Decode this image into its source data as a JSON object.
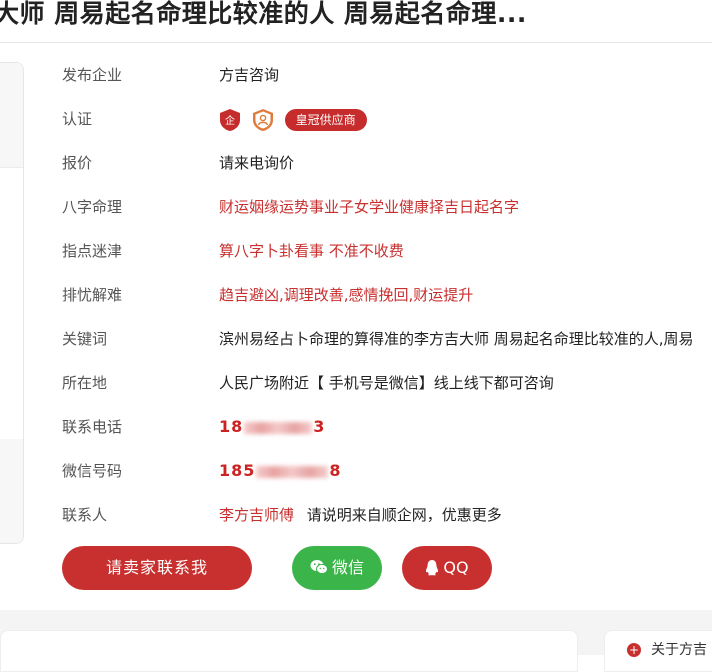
{
  "title": "大师 周易起名命理比较准的人 周易起名命理...",
  "details": {
    "publisher": {
      "label": "发布企业",
      "value": "方吉咨询"
    },
    "certification": {
      "label": "认证",
      "badge": "皇冠供应商",
      "icons": [
        "enterprise-cert-icon",
        "personal-cert-icon"
      ]
    },
    "price": {
      "label": "报价",
      "value": "请来电询价"
    },
    "bazi": {
      "label": "八字命理",
      "value": "财运姻缘运势事业子女学业健康择吉日起名字"
    },
    "guidance": {
      "label": "指点迷津",
      "value": "算八字卜卦看事 不准不收费"
    },
    "relief": {
      "label": "排忧解难",
      "value": "趋吉避凶,调理改善,感情挽回,财运提升"
    },
    "keywords": {
      "label": "关键词",
      "value": "滨州易经占卜命理的算得准的李方吉大师 周易起名命理比较准的人,周易"
    },
    "location": {
      "label": "所在地",
      "value": "人民广场附近【 手机号是微信】线上线下都可咨询"
    },
    "phone": {
      "label": "联系电话",
      "prefix": "18",
      "suffix": "3"
    },
    "wechat": {
      "label": "微信号码",
      "prefix": "185",
      "suffix": "8"
    },
    "contact": {
      "label": "联系人",
      "name": "李方吉师傅",
      "note": "请说明来自顺企网，优惠更多"
    }
  },
  "buttons": {
    "contact": "请卖家联系我",
    "wechat": "微信",
    "qq": "QQ"
  },
  "bottom": {
    "about": "关于方吉"
  },
  "colors": {
    "accent": "#c8302f",
    "wechat": "#3bb44a"
  }
}
